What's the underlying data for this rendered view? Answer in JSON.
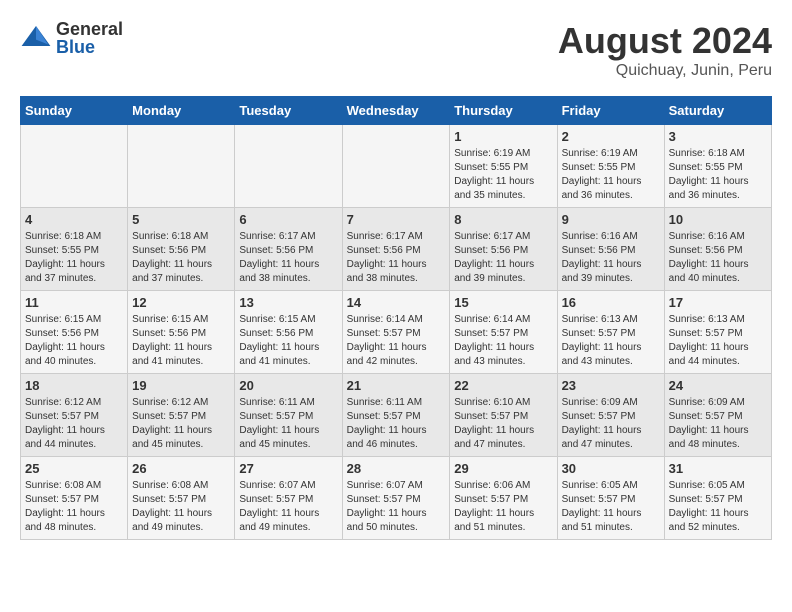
{
  "logo": {
    "general": "General",
    "blue": "Blue"
  },
  "title": "August 2024",
  "subtitle": "Quichuay, Junin, Peru",
  "days_of_week": [
    "Sunday",
    "Monday",
    "Tuesday",
    "Wednesday",
    "Thursday",
    "Friday",
    "Saturday"
  ],
  "weeks": [
    [
      {
        "day": "",
        "info": ""
      },
      {
        "day": "",
        "info": ""
      },
      {
        "day": "",
        "info": ""
      },
      {
        "day": "",
        "info": ""
      },
      {
        "day": "1",
        "info": "Sunrise: 6:19 AM\nSunset: 5:55 PM\nDaylight: 11 hours\nand 35 minutes."
      },
      {
        "day": "2",
        "info": "Sunrise: 6:19 AM\nSunset: 5:55 PM\nDaylight: 11 hours\nand 36 minutes."
      },
      {
        "day": "3",
        "info": "Sunrise: 6:18 AM\nSunset: 5:55 PM\nDaylight: 11 hours\nand 36 minutes."
      }
    ],
    [
      {
        "day": "4",
        "info": "Sunrise: 6:18 AM\nSunset: 5:55 PM\nDaylight: 11 hours\nand 37 minutes."
      },
      {
        "day": "5",
        "info": "Sunrise: 6:18 AM\nSunset: 5:56 PM\nDaylight: 11 hours\nand 37 minutes."
      },
      {
        "day": "6",
        "info": "Sunrise: 6:17 AM\nSunset: 5:56 PM\nDaylight: 11 hours\nand 38 minutes."
      },
      {
        "day": "7",
        "info": "Sunrise: 6:17 AM\nSunset: 5:56 PM\nDaylight: 11 hours\nand 38 minutes."
      },
      {
        "day": "8",
        "info": "Sunrise: 6:17 AM\nSunset: 5:56 PM\nDaylight: 11 hours\nand 39 minutes."
      },
      {
        "day": "9",
        "info": "Sunrise: 6:16 AM\nSunset: 5:56 PM\nDaylight: 11 hours\nand 39 minutes."
      },
      {
        "day": "10",
        "info": "Sunrise: 6:16 AM\nSunset: 5:56 PM\nDaylight: 11 hours\nand 40 minutes."
      }
    ],
    [
      {
        "day": "11",
        "info": "Sunrise: 6:15 AM\nSunset: 5:56 PM\nDaylight: 11 hours\nand 40 minutes."
      },
      {
        "day": "12",
        "info": "Sunrise: 6:15 AM\nSunset: 5:56 PM\nDaylight: 11 hours\nand 41 minutes."
      },
      {
        "day": "13",
        "info": "Sunrise: 6:15 AM\nSunset: 5:56 PM\nDaylight: 11 hours\nand 41 minutes."
      },
      {
        "day": "14",
        "info": "Sunrise: 6:14 AM\nSunset: 5:57 PM\nDaylight: 11 hours\nand 42 minutes."
      },
      {
        "day": "15",
        "info": "Sunrise: 6:14 AM\nSunset: 5:57 PM\nDaylight: 11 hours\nand 43 minutes."
      },
      {
        "day": "16",
        "info": "Sunrise: 6:13 AM\nSunset: 5:57 PM\nDaylight: 11 hours\nand 43 minutes."
      },
      {
        "day": "17",
        "info": "Sunrise: 6:13 AM\nSunset: 5:57 PM\nDaylight: 11 hours\nand 44 minutes."
      }
    ],
    [
      {
        "day": "18",
        "info": "Sunrise: 6:12 AM\nSunset: 5:57 PM\nDaylight: 11 hours\nand 44 minutes."
      },
      {
        "day": "19",
        "info": "Sunrise: 6:12 AM\nSunset: 5:57 PM\nDaylight: 11 hours\nand 45 minutes."
      },
      {
        "day": "20",
        "info": "Sunrise: 6:11 AM\nSunset: 5:57 PM\nDaylight: 11 hours\nand 45 minutes."
      },
      {
        "day": "21",
        "info": "Sunrise: 6:11 AM\nSunset: 5:57 PM\nDaylight: 11 hours\nand 46 minutes."
      },
      {
        "day": "22",
        "info": "Sunrise: 6:10 AM\nSunset: 5:57 PM\nDaylight: 11 hours\nand 47 minutes."
      },
      {
        "day": "23",
        "info": "Sunrise: 6:09 AM\nSunset: 5:57 PM\nDaylight: 11 hours\nand 47 minutes."
      },
      {
        "day": "24",
        "info": "Sunrise: 6:09 AM\nSunset: 5:57 PM\nDaylight: 11 hours\nand 48 minutes."
      }
    ],
    [
      {
        "day": "25",
        "info": "Sunrise: 6:08 AM\nSunset: 5:57 PM\nDaylight: 11 hours\nand 48 minutes."
      },
      {
        "day": "26",
        "info": "Sunrise: 6:08 AM\nSunset: 5:57 PM\nDaylight: 11 hours\nand 49 minutes."
      },
      {
        "day": "27",
        "info": "Sunrise: 6:07 AM\nSunset: 5:57 PM\nDaylight: 11 hours\nand 49 minutes."
      },
      {
        "day": "28",
        "info": "Sunrise: 6:07 AM\nSunset: 5:57 PM\nDaylight: 11 hours\nand 50 minutes."
      },
      {
        "day": "29",
        "info": "Sunrise: 6:06 AM\nSunset: 5:57 PM\nDaylight: 11 hours\nand 51 minutes."
      },
      {
        "day": "30",
        "info": "Sunrise: 6:05 AM\nSunset: 5:57 PM\nDaylight: 11 hours\nand 51 minutes."
      },
      {
        "day": "31",
        "info": "Sunrise: 6:05 AM\nSunset: 5:57 PM\nDaylight: 11 hours\nand 52 minutes."
      }
    ]
  ]
}
